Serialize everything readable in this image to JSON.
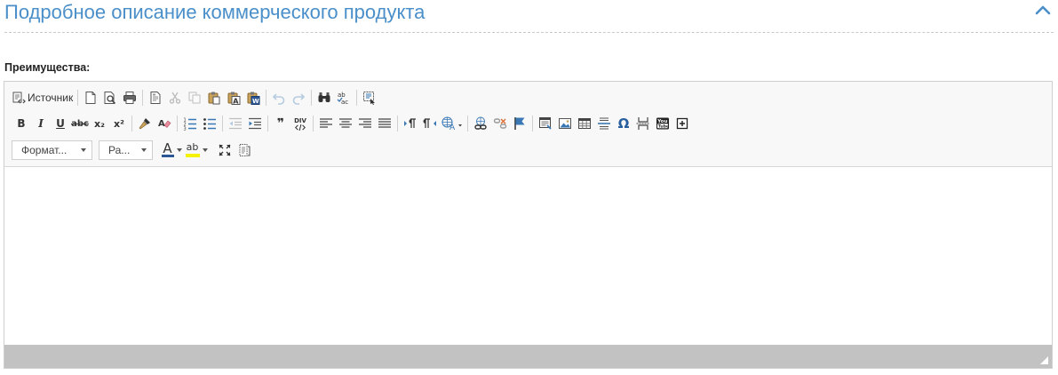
{
  "section": {
    "title": "Подробное описание коммерческого продукта",
    "collapse_icon": "chevron-up-icon"
  },
  "field": {
    "label": "Преимущества:"
  },
  "editor": {
    "toolbar_row1": {
      "source_label": "Источник",
      "icons": [
        "source-icon",
        "new-page-icon",
        "preview-icon",
        "print-icon",
        "templates-icon",
        "cut-icon",
        "copy-icon",
        "paste-icon",
        "paste-text-icon",
        "paste-word-icon",
        "undo-icon",
        "redo-icon",
        "find-icon",
        "spellcheck-icon",
        "select-all-icon"
      ]
    },
    "toolbar_row2": {
      "bold_glyph": "B",
      "italic_glyph": "I",
      "underline_glyph": "U",
      "strike_glyph": "abc",
      "subscript_glyph": "x₂",
      "superscript_glyph": "x²",
      "blockquote_glyph": "❞",
      "div_glyph": "DIV",
      "omega_glyph": "Ω",
      "icons": [
        "copy-format-icon",
        "remove-format-icon",
        "numbered-list-icon",
        "bulleted-list-icon",
        "outdent-icon",
        "indent-icon",
        "blockquote-icon",
        "div-container-icon",
        "align-left-icon",
        "align-center-icon",
        "align-right-icon",
        "justify-icon",
        "ltr-icon",
        "rtl-icon",
        "language-icon",
        "link-icon",
        "unlink-icon",
        "anchor-icon",
        "iframe-icon",
        "image-icon",
        "table-icon",
        "horizontal-line-icon",
        "special-char-icon",
        "page-break-icon",
        "youtube-icon",
        "plus-box-icon"
      ]
    },
    "toolbar_row3": {
      "format_combo": "Формат...",
      "size_combo": "Ра...",
      "text_color_glyph": "A",
      "bg_color_glyph": "ab",
      "icons": [
        "text-color-icon",
        "bg-color-icon",
        "maximize-icon",
        "show-blocks-icon"
      ]
    },
    "content": ""
  },
  "colors": {
    "title": "#4a8fc9",
    "statusbar": "#c2c2c2",
    "toolbar_bg": "#f8f8f8",
    "link_blue": "#3a78b5"
  }
}
